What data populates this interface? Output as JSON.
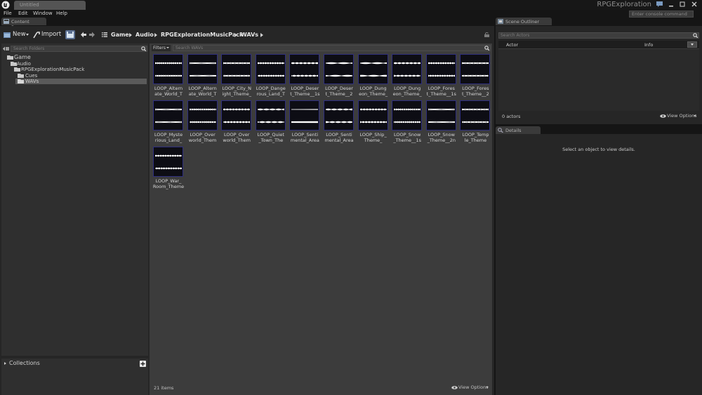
{
  "app": {
    "document_tab": "Untitled",
    "project_name": "RPGExploration"
  },
  "menu": [
    "File",
    "Edit",
    "Window",
    "Help"
  ],
  "console": {
    "placeholder": "Enter console command"
  },
  "content_browser": {
    "tab_label": "Content Browser",
    "toolbar": {
      "new_label": "New",
      "import_label": "Import"
    },
    "breadcrumb": [
      "Game",
      "Audio",
      "RPGExplorationMusicPack",
      "WAVs"
    ],
    "folder_search_placeholder": "Search Folders",
    "tree": [
      {
        "label": "Game",
        "level": 0
      },
      {
        "label": "Audio",
        "level": 1
      },
      {
        "label": "RPGExplorationMusicPack",
        "level": 2
      },
      {
        "label": "Cues",
        "level": 3
      },
      {
        "label": "WAVs",
        "level": 3,
        "selected": true
      }
    ],
    "collections_label": "Collections",
    "filters_label": "Filters",
    "asset_search_placeholder": "Search WAVs",
    "assets": [
      "LOOP_Altern\nate_World_T",
      "LOOP_Altern\nate_World_T",
      "LOOP_City_N\night_Theme_",
      "LOOP_Dange\nrous_Land_T",
      "LOOP_Deser\nt_Theme__1s",
      "LOOP_Deser\nt_Theme__2",
      "LOOP_Dung\neon_Theme_",
      "LOOP_Dung\neon_Theme_",
      "LOOP_Fores\nt_Theme__1s",
      "LOOP_Fores\nt_Theme__2",
      "LOOP_Myste\nrious_Land_",
      "LOOP_Over\nworld_Them",
      "LOOP_Over\nworld_Them",
      "LOOP_Quiet\n_Town_The",
      "LOOP_Senti\nmental_Area",
      "LOOP_Senti\nmental_Area",
      "LOOP_Ship_\nTheme_",
      "LOOP_Snow\n_Theme__1s",
      "LOOP_Snow\n_Theme__2n",
      "LOOP_Temp\nle_Theme",
      "LOOP_War_\nRoom_Theme"
    ],
    "item_count": "21 items",
    "view_options": "View Options"
  },
  "scene_outliner": {
    "tab_label": "Scene Outliner",
    "search_placeholder": "Search Actors",
    "columns": [
      "Actor",
      "Info"
    ],
    "actor_count": "0 actors",
    "view_options": "View Options"
  },
  "details": {
    "tab_label": "Details",
    "empty_message": "Select an object to view details."
  },
  "colors": {
    "thumbnail_border": "#2f2f7f",
    "background": "#151515",
    "panel": "#262626"
  }
}
